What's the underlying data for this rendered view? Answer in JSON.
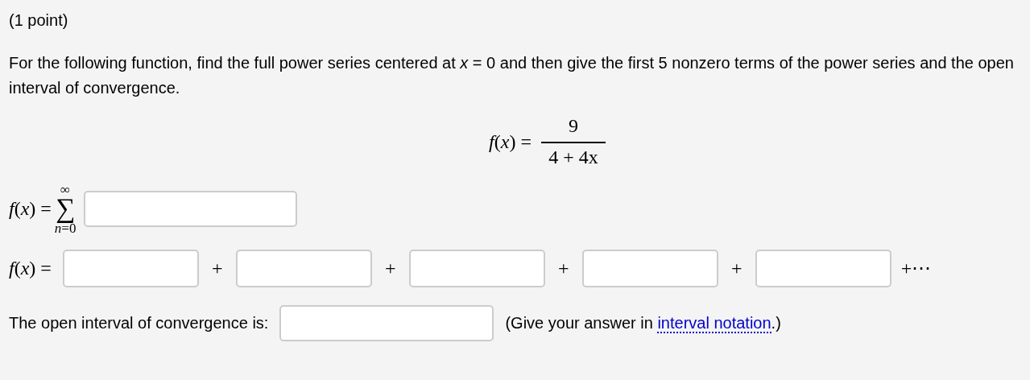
{
  "points": "(1 point)",
  "instructions": "For the following function, find the full power series centered at *x* = 0 and then give the first 5 nonzero terms of the power series and the open interval of convergence.",
  "formula": {
    "lhs": "*f*(*x*) =",
    "numerator": "9",
    "denominator": "4 + 4x"
  },
  "series_row": {
    "lhs": "*f*(*x*) =",
    "upper": "∞",
    "symbol": "∑",
    "lower": "*n*=0"
  },
  "terms_row": {
    "lhs": "*f*(*x*) =",
    "separators": [
      "+",
      "+",
      "+",
      "+",
      "+⋯"
    ]
  },
  "interval_row": {
    "label": "The open interval of convergence is:",
    "hint_before": "(Give your answer in ",
    "link": "interval notation",
    "hint_after": ".)"
  }
}
